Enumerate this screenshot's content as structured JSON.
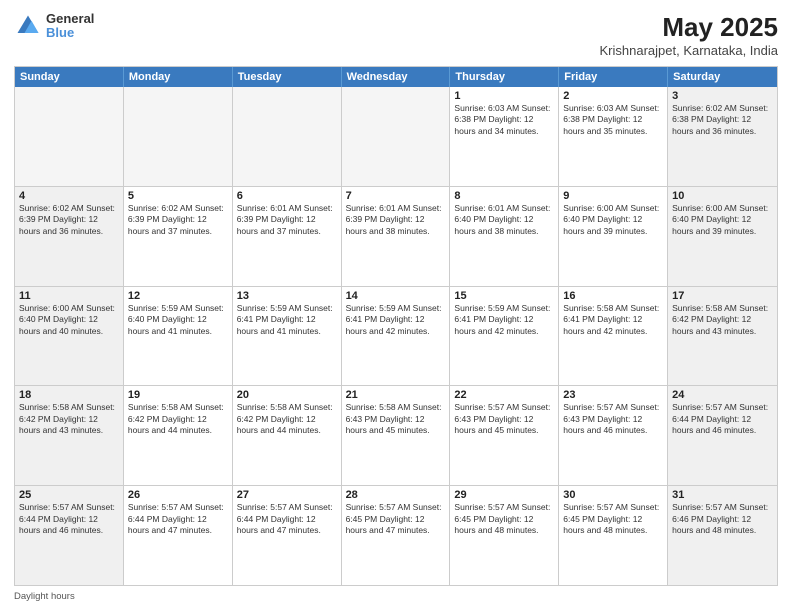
{
  "header": {
    "title": "May 2025",
    "subtitle": "Krishnarajpet, Karnataka, India",
    "logo_line1": "General",
    "logo_line2": "Blue"
  },
  "weekdays": [
    "Sunday",
    "Monday",
    "Tuesday",
    "Wednesday",
    "Thursday",
    "Friday",
    "Saturday"
  ],
  "footer_label": "Daylight hours",
  "weeks": [
    [
      {
        "day": "",
        "info": "",
        "empty": true
      },
      {
        "day": "",
        "info": "",
        "empty": true
      },
      {
        "day": "",
        "info": "",
        "empty": true
      },
      {
        "day": "",
        "info": "",
        "empty": true
      },
      {
        "day": "1",
        "info": "Sunrise: 6:03 AM\nSunset: 6:38 PM\nDaylight: 12 hours\nand 34 minutes.",
        "empty": false
      },
      {
        "day": "2",
        "info": "Sunrise: 6:03 AM\nSunset: 6:38 PM\nDaylight: 12 hours\nand 35 minutes.",
        "empty": false
      },
      {
        "day": "3",
        "info": "Sunrise: 6:02 AM\nSunset: 6:38 PM\nDaylight: 12 hours\nand 36 minutes.",
        "empty": false
      }
    ],
    [
      {
        "day": "4",
        "info": "Sunrise: 6:02 AM\nSunset: 6:39 PM\nDaylight: 12 hours\nand 36 minutes.",
        "empty": false
      },
      {
        "day": "5",
        "info": "Sunrise: 6:02 AM\nSunset: 6:39 PM\nDaylight: 12 hours\nand 37 minutes.",
        "empty": false
      },
      {
        "day": "6",
        "info": "Sunrise: 6:01 AM\nSunset: 6:39 PM\nDaylight: 12 hours\nand 37 minutes.",
        "empty": false
      },
      {
        "day": "7",
        "info": "Sunrise: 6:01 AM\nSunset: 6:39 PM\nDaylight: 12 hours\nand 38 minutes.",
        "empty": false
      },
      {
        "day": "8",
        "info": "Sunrise: 6:01 AM\nSunset: 6:40 PM\nDaylight: 12 hours\nand 38 minutes.",
        "empty": false
      },
      {
        "day": "9",
        "info": "Sunrise: 6:00 AM\nSunset: 6:40 PM\nDaylight: 12 hours\nand 39 minutes.",
        "empty": false
      },
      {
        "day": "10",
        "info": "Sunrise: 6:00 AM\nSunset: 6:40 PM\nDaylight: 12 hours\nand 39 minutes.",
        "empty": false
      }
    ],
    [
      {
        "day": "11",
        "info": "Sunrise: 6:00 AM\nSunset: 6:40 PM\nDaylight: 12 hours\nand 40 minutes.",
        "empty": false
      },
      {
        "day": "12",
        "info": "Sunrise: 5:59 AM\nSunset: 6:40 PM\nDaylight: 12 hours\nand 41 minutes.",
        "empty": false
      },
      {
        "day": "13",
        "info": "Sunrise: 5:59 AM\nSunset: 6:41 PM\nDaylight: 12 hours\nand 41 minutes.",
        "empty": false
      },
      {
        "day": "14",
        "info": "Sunrise: 5:59 AM\nSunset: 6:41 PM\nDaylight: 12 hours\nand 42 minutes.",
        "empty": false
      },
      {
        "day": "15",
        "info": "Sunrise: 5:59 AM\nSunset: 6:41 PM\nDaylight: 12 hours\nand 42 minutes.",
        "empty": false
      },
      {
        "day": "16",
        "info": "Sunrise: 5:58 AM\nSunset: 6:41 PM\nDaylight: 12 hours\nand 42 minutes.",
        "empty": false
      },
      {
        "day": "17",
        "info": "Sunrise: 5:58 AM\nSunset: 6:42 PM\nDaylight: 12 hours\nand 43 minutes.",
        "empty": false
      }
    ],
    [
      {
        "day": "18",
        "info": "Sunrise: 5:58 AM\nSunset: 6:42 PM\nDaylight: 12 hours\nand 43 minutes.",
        "empty": false
      },
      {
        "day": "19",
        "info": "Sunrise: 5:58 AM\nSunset: 6:42 PM\nDaylight: 12 hours\nand 44 minutes.",
        "empty": false
      },
      {
        "day": "20",
        "info": "Sunrise: 5:58 AM\nSunset: 6:42 PM\nDaylight: 12 hours\nand 44 minutes.",
        "empty": false
      },
      {
        "day": "21",
        "info": "Sunrise: 5:58 AM\nSunset: 6:43 PM\nDaylight: 12 hours\nand 45 minutes.",
        "empty": false
      },
      {
        "day": "22",
        "info": "Sunrise: 5:57 AM\nSunset: 6:43 PM\nDaylight: 12 hours\nand 45 minutes.",
        "empty": false
      },
      {
        "day": "23",
        "info": "Sunrise: 5:57 AM\nSunset: 6:43 PM\nDaylight: 12 hours\nand 46 minutes.",
        "empty": false
      },
      {
        "day": "24",
        "info": "Sunrise: 5:57 AM\nSunset: 6:44 PM\nDaylight: 12 hours\nand 46 minutes.",
        "empty": false
      }
    ],
    [
      {
        "day": "25",
        "info": "Sunrise: 5:57 AM\nSunset: 6:44 PM\nDaylight: 12 hours\nand 46 minutes.",
        "empty": false
      },
      {
        "day": "26",
        "info": "Sunrise: 5:57 AM\nSunset: 6:44 PM\nDaylight: 12 hours\nand 47 minutes.",
        "empty": false
      },
      {
        "day": "27",
        "info": "Sunrise: 5:57 AM\nSunset: 6:44 PM\nDaylight: 12 hours\nand 47 minutes.",
        "empty": false
      },
      {
        "day": "28",
        "info": "Sunrise: 5:57 AM\nSunset: 6:45 PM\nDaylight: 12 hours\nand 47 minutes.",
        "empty": false
      },
      {
        "day": "29",
        "info": "Sunrise: 5:57 AM\nSunset: 6:45 PM\nDaylight: 12 hours\nand 48 minutes.",
        "empty": false
      },
      {
        "day": "30",
        "info": "Sunrise: 5:57 AM\nSunset: 6:45 PM\nDaylight: 12 hours\nand 48 minutes.",
        "empty": false
      },
      {
        "day": "31",
        "info": "Sunrise: 5:57 AM\nSunset: 6:46 PM\nDaylight: 12 hours\nand 48 minutes.",
        "empty": false
      }
    ]
  ]
}
